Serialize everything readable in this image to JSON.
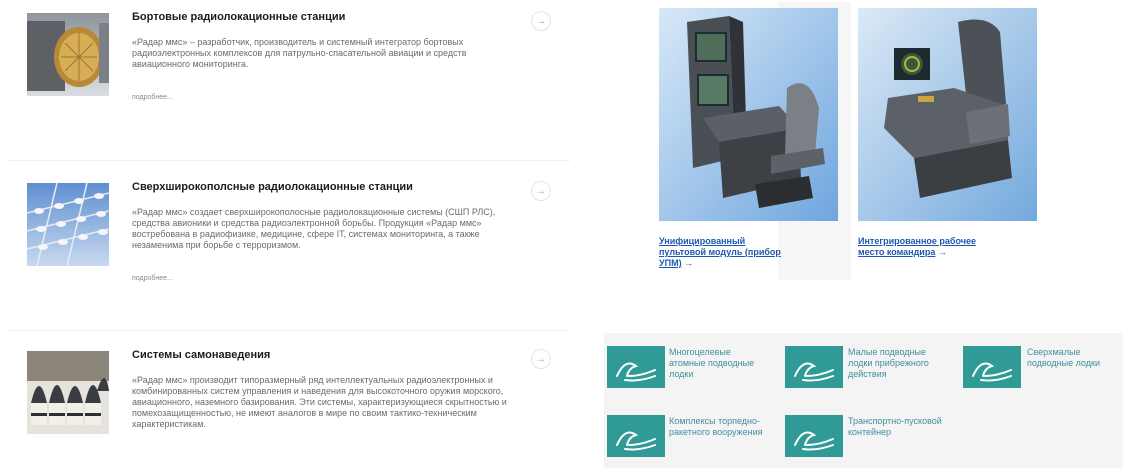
{
  "items": [
    {
      "title": "Бортовые радиолокационные станции",
      "desc": "«Радар ммс» – разработчик, производитель и системный интегратор бортовых радиоэлектронных комплексов для патрульно-спасательной авиации и средств авиационного мониторинга.",
      "more": "подробнее..."
    },
    {
      "title": "Сверхширокополсные радиолокационные станции",
      "desc": "«Радар ммс» создает сверхширокополосные радиолокационные системы (СШП РЛС), средства авионики и средства радиоэлектронной борьбы. Продукция «Радар ммс» востребована в радиофизике, медицине, сфере IT, системах мониторинга, а также незаменима при борьбе с терроризмом.",
      "more": "подробнее..."
    },
    {
      "title": "Системы самонаведения",
      "desc": "«Радар ммс» производит типоразмерный ряд интеллектуальных радиоэлектронных и комбинированных систем управления и наведения для высокоточного оружия морского, авиационного, наземного базирования. Эти системы, характеризующиеся скрытностью и помехозащищенностью, не имеют аналогов в мире по своим тактико-техническим характеристикам.",
      "more": ""
    }
  ],
  "arrow_glyph": "→",
  "cards": [
    {
      "line1": "Унифицированный",
      "line2": "пультовой модуль (прибор",
      "line3": "УПМ)",
      "arrow": "→"
    },
    {
      "line1": "Интегрированное рабочее",
      "line2": "место командира",
      "arrow": "→"
    }
  ],
  "tiles": [
    {
      "l1": "Многоцелевые",
      "l2": "атомные подводные",
      "l3": "лодки"
    },
    {
      "l1": "Малые подводные",
      "l2": "лодки прибрежного",
      "l3": "действия"
    },
    {
      "l1": "Сверхмалые",
      "l2": "подводные лодки",
      "l3": ""
    },
    {
      "l1": "Комплексы торпедно-",
      "l2": "ракетного вооружения",
      "l3": ""
    },
    {
      "l1": "Транспортно-пусковой",
      "l2": "контейнер",
      "l3": ""
    }
  ],
  "colors": {
    "link": "#1f57b0",
    "tile": "#2f9a96",
    "tile_text": "#3f8f9c"
  },
  "icons": [
    "radar-antenna-image",
    "uwb-antenna-image",
    "seeker-heads-image",
    "console-module-image",
    "commander-seat-image",
    "wave-logo-icon"
  ]
}
